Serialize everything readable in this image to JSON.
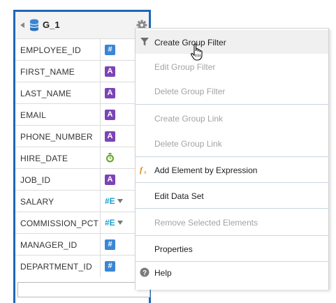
{
  "group": {
    "title": "G_1",
    "icons": {
      "collapse": "collapse-triangle-icon",
      "database": "database-icon",
      "settings": "gear-icon"
    },
    "elements": [
      {
        "name": "EMPLOYEE_ID",
        "type_icon": "number-icon",
        "type_glyph": "#"
      },
      {
        "name": "FIRST_NAME",
        "type_icon": "text-icon",
        "type_glyph": "A"
      },
      {
        "name": "LAST_NAME",
        "type_icon": "text-icon",
        "type_glyph": "A"
      },
      {
        "name": "EMAIL",
        "type_icon": "text-icon",
        "type_glyph": "A"
      },
      {
        "name": "PHONE_NUMBER",
        "type_icon": "text-icon",
        "type_glyph": "A"
      },
      {
        "name": "HIRE_DATE",
        "type_icon": "date-icon",
        "type_glyph": ""
      },
      {
        "name": "JOB_ID",
        "type_icon": "text-icon",
        "type_glyph": "A"
      },
      {
        "name": "SALARY",
        "type_icon": "aggregate-number-icon",
        "type_glyph": "#E"
      },
      {
        "name": "COMMISSION_PCT",
        "type_icon": "aggregate-number-icon",
        "type_glyph": "#E"
      },
      {
        "name": "MANAGER_ID",
        "type_icon": "number-icon",
        "type_glyph": "#"
      },
      {
        "name": "DEPARTMENT_ID",
        "type_icon": "number-icon",
        "type_glyph": "#"
      }
    ]
  },
  "menu": {
    "items": [
      {
        "label": "Create Group Filter",
        "enabled": true,
        "icon": "filter-icon",
        "hover": true
      },
      {
        "label": "Edit Group Filter",
        "enabled": false
      },
      {
        "label": "Delete Group Filter",
        "enabled": false
      },
      {
        "label": "Create Group Link",
        "enabled": false
      },
      {
        "label": "Delete Group Link",
        "enabled": false
      },
      {
        "label": "Add Element by Expression",
        "enabled": true,
        "icon": "function-icon"
      },
      {
        "label": "Edit Data Set",
        "enabled": true
      },
      {
        "label": "Remove Selected Elements",
        "enabled": false
      },
      {
        "label": "Properties",
        "enabled": true
      },
      {
        "label": "Help",
        "enabled": true,
        "icon": "help-icon"
      }
    ],
    "cursor_icon": "hand-pointer-icon"
  },
  "colors": {
    "panel_border": "#1f66b8",
    "number_badge": "#3b86d4",
    "text_badge": "#7b45b5",
    "disabled_text": "#a3a3a3"
  }
}
